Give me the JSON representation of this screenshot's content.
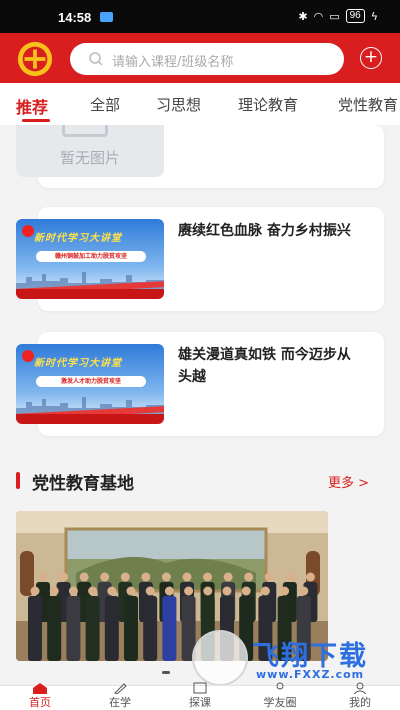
{
  "status_bar": {
    "time": "14:58",
    "battery": "96"
  },
  "header": {
    "search_placeholder": "请输入课程/班级名称"
  },
  "tabs": [
    {
      "label": "推荐",
      "active": true
    },
    {
      "label": "全部"
    },
    {
      "label": "习思想"
    },
    {
      "label": "理论教育"
    },
    {
      "label": "党性教育"
    }
  ],
  "courses": {
    "no_image_text": "暂无图片",
    "items": [
      {
        "title": "赓续红色血脉 奋力乡村振兴",
        "banner": "新时代学习大讲堂",
        "subtitle": "赣州铜鼓加工助力脱贫攻坚"
      },
      {
        "title": "雄关漫道真如铁 而今迈步从头越",
        "banner": "新时代学习大讲堂",
        "subtitle": "激发人才助力脱贫攻坚"
      }
    ]
  },
  "section": {
    "title": "党性教育基地",
    "more": "更多 >"
  },
  "bottom_nav": [
    {
      "label": "首页",
      "icon": "home-icon",
      "active": true
    },
    {
      "label": "在学",
      "icon": "pen-icon"
    },
    {
      "label": "探课",
      "icon": "book-icon"
    },
    {
      "label": "学友圈",
      "icon": "friends-icon"
    },
    {
      "label": "我的",
      "icon": "user-icon"
    }
  ],
  "watermark": {
    "text": "飞翔下载",
    "url": "www.FXXZ.com"
  },
  "colors": {
    "brand_red": "#d81e1e",
    "background": "#f3f3f3"
  }
}
